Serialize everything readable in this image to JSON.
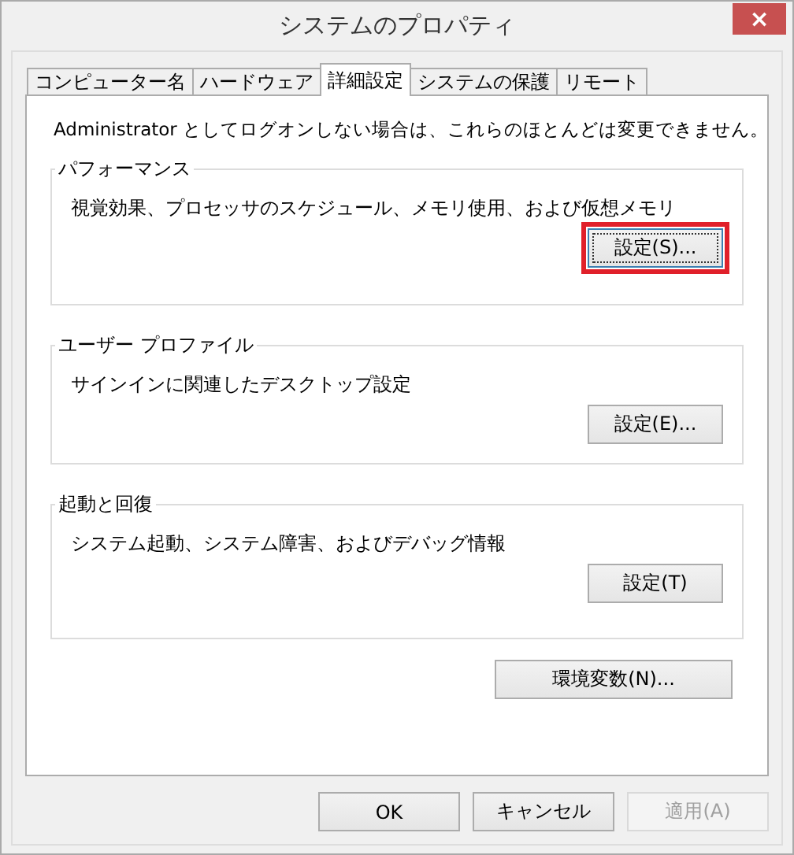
{
  "window": {
    "title": "システムのプロパティ",
    "close": "×"
  },
  "tabs": [
    {
      "label": "コンピューター名",
      "selected": false
    },
    {
      "label": "ハードウェア",
      "selected": false
    },
    {
      "label": "詳細設定",
      "selected": true
    },
    {
      "label": "システムの保護",
      "selected": false
    },
    {
      "label": "リモート",
      "selected": false
    }
  ],
  "notice": "Administrator としてログオンしない場合は、これらのほとんどは変更できません。",
  "groups": [
    {
      "title": "パフォーマンス",
      "description": "視覚効果、プロセッサのスケジュール、メモリ使用、および仮想メモリ",
      "button": {
        "label": "設定(S)...",
        "highlighted": true,
        "focused": true
      }
    },
    {
      "title": "ユーザー プロファイル",
      "description": "サインインに関連したデスクトップ設定",
      "button": {
        "label": "設定(E)...",
        "highlighted": false,
        "focused": false
      }
    },
    {
      "title": "起動と回復",
      "description": "システム起動、システム障害、およびデバッグ情報",
      "button": {
        "label": "設定(T)",
        "highlighted": false,
        "focused": false
      }
    }
  ],
  "environment_button": {
    "label": "環境変数(N)..."
  },
  "dialog_buttons": [
    {
      "label": "OK",
      "disabled": false
    },
    {
      "label": "キャンセル",
      "disabled": false
    },
    {
      "label": "適用(A)",
      "disabled": true
    }
  ]
}
